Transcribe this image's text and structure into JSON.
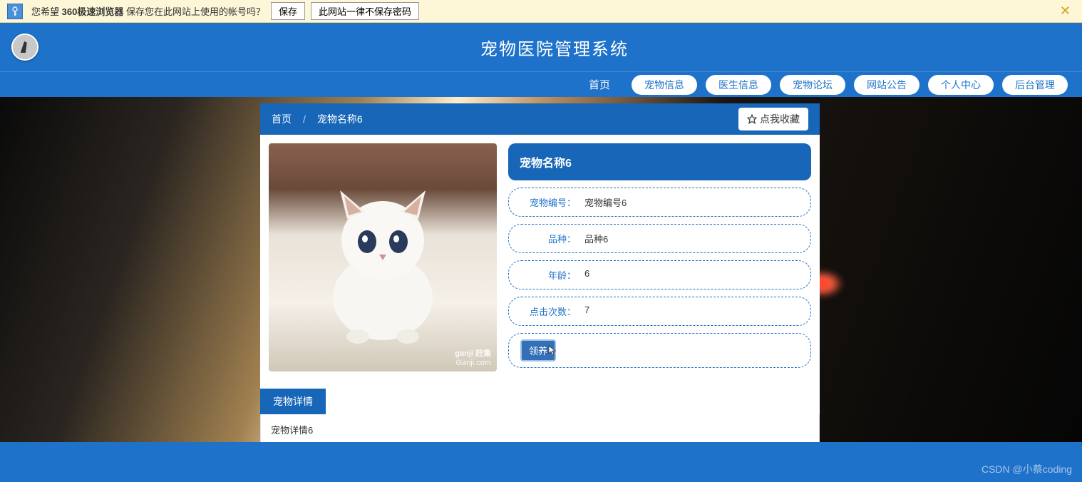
{
  "notification": {
    "prefix": "您希望 ",
    "bold": "360极速浏览器",
    "suffix": " 保存您在此网站上使用的帐号吗？",
    "save": "保存",
    "never": "此网站一律不保存密码"
  },
  "header": {
    "title": "宠物医院管理系统"
  },
  "nav": {
    "home": "首页",
    "items": [
      "宠物信息",
      "医生信息",
      "宠物论坛",
      "网站公告",
      "个人中心",
      "后台管理"
    ]
  },
  "breadcrumb": {
    "home": "首页",
    "sep": "/",
    "current": "宠物名称6"
  },
  "favorite": {
    "label": "点我收藏"
  },
  "pet": {
    "title": "宠物名称6",
    "rows": [
      {
        "label": "宠物编号：",
        "value": "宠物编号6"
      },
      {
        "label": "品种：",
        "value": "品种6"
      },
      {
        "label": "年龄：",
        "value": "6"
      },
      {
        "label": "点击次数：",
        "value": "7"
      }
    ],
    "action": "领养"
  },
  "tabs": {
    "active": "宠物详情",
    "content": "宠物详情6"
  },
  "watermark": {
    "line1": "ganji 赶集",
    "line2": "Ganji.com"
  },
  "csdn": "CSDN @小蔡coding"
}
